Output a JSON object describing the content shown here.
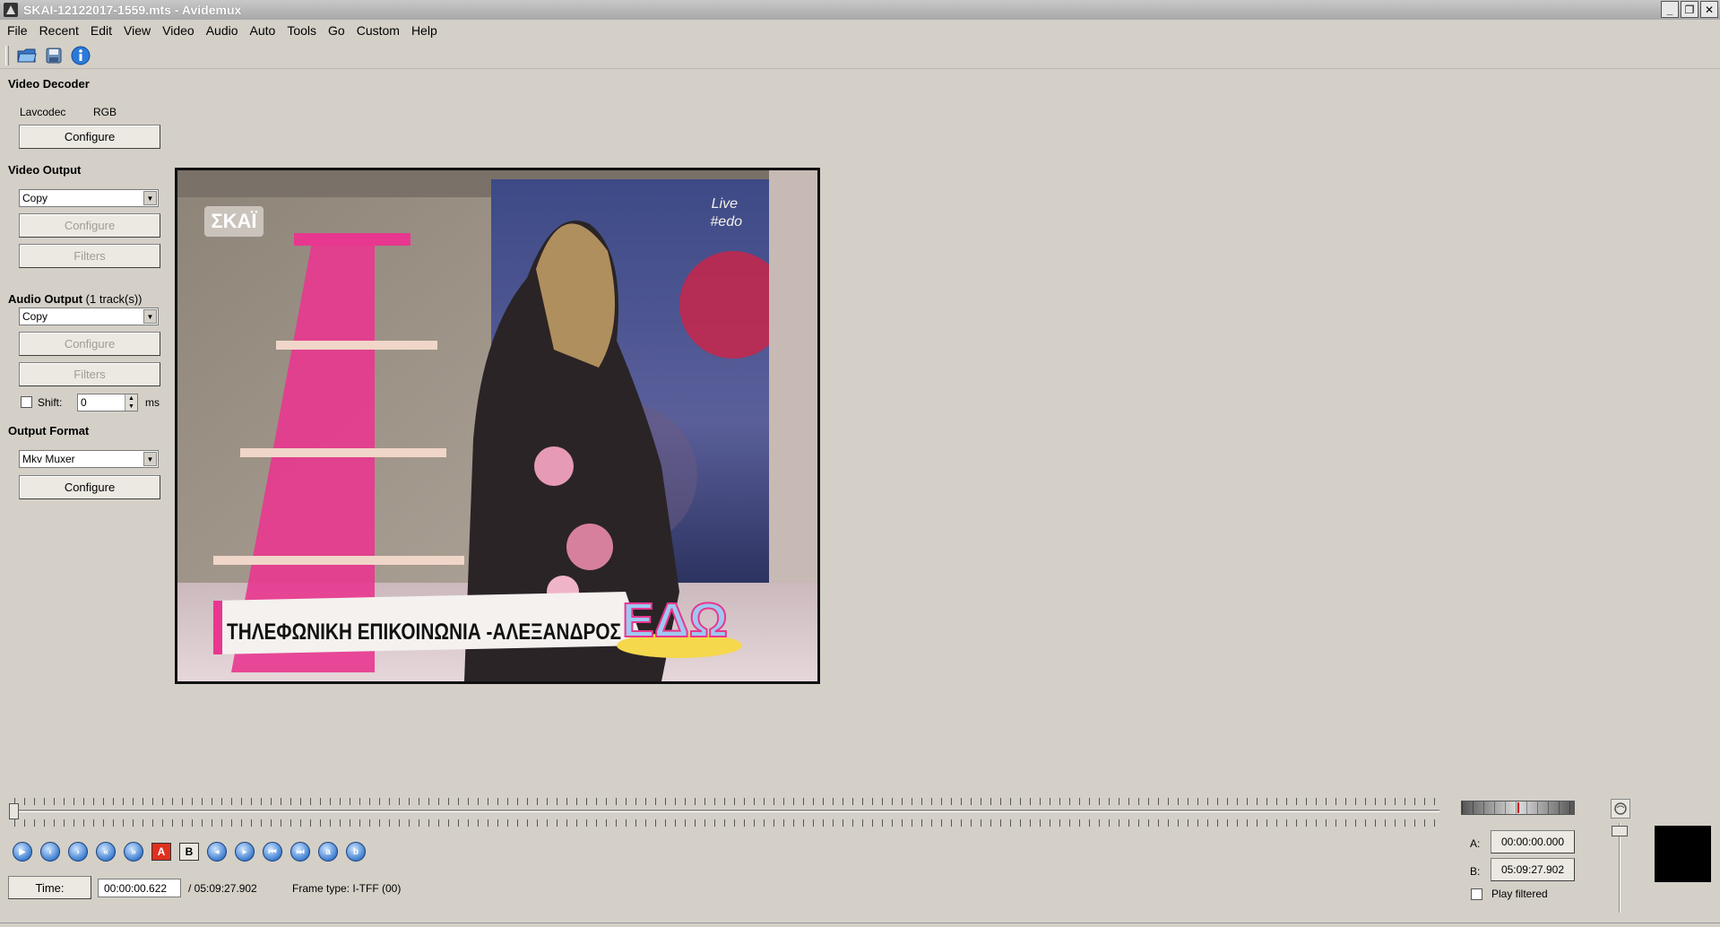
{
  "window": {
    "title": "SKAI-12122017-1559.mts - Avidemux",
    "minimize": "_",
    "restore": "❐",
    "close": "✕"
  },
  "menu": [
    "File",
    "Recent",
    "Edit",
    "View",
    "Video",
    "Audio",
    "Auto",
    "Tools",
    "Go",
    "Custom",
    "Help"
  ],
  "toolbar": {
    "icons": [
      "open-folder-icon",
      "save-icon",
      "info-icon"
    ]
  },
  "video_decoder": {
    "title": "Video Decoder",
    "decoder": "Lavcodec",
    "colorspace": "RGB",
    "configure": "Configure"
  },
  "video_output": {
    "title": "Video Output",
    "codec": "Copy",
    "configure": "Configure",
    "filters": "Filters"
  },
  "audio_output": {
    "title": "Audio Output",
    "tracks": "(1 track(s))",
    "codec": "Copy",
    "configure": "Configure",
    "filters": "Filters",
    "shift_label": "Shift:",
    "shift_value": "0",
    "shift_unit": "ms"
  },
  "output_format": {
    "title": "Output Format",
    "muxer": "Mkv Muxer",
    "configure": "Configure"
  },
  "video_frame": {
    "channel_logo": "ΣΚΑΪ",
    "live_text": "Live",
    "hashtag": "#edo",
    "caption": "ΤΗΛΕΦΩΝΙΚΗ ΕΠΙΚΟΙΝΩΝΙΑ -ΑΛΕΞΑΝΔΡΟΣ",
    "show_logo": "ΕΔΩ"
  },
  "navigation": {
    "buttons": [
      "play-icon",
      "previous-frame-icon",
      "next-frame-icon",
      "previous-keyframe-icon",
      "next-keyframe-icon",
      "set-marker-a-icon",
      "set-marker-b-icon",
      "previous-black-frame-icon",
      "next-black-frame-icon",
      "first-frame-icon",
      "last-frame-icon",
      "go-to-marker-a-icon",
      "go-to-marker-b-icon"
    ],
    "marker_a": "A",
    "marker_b": "B"
  },
  "time": {
    "button": "Time:",
    "current": "00:00:00.622",
    "total": "/ 05:09:27.902",
    "frame_type": "Frame type:  I-TFF (00)"
  },
  "selection": {
    "a_label": "A:",
    "a_value": "00:00:00.000",
    "b_label": "B:",
    "b_value": "05:09:27.902",
    "play_filtered": "Play filtered"
  },
  "colors": {
    "accent_pink": "#e8378f",
    "nav_blue": "#3f7fd0",
    "marker_red": "#e0301e"
  }
}
